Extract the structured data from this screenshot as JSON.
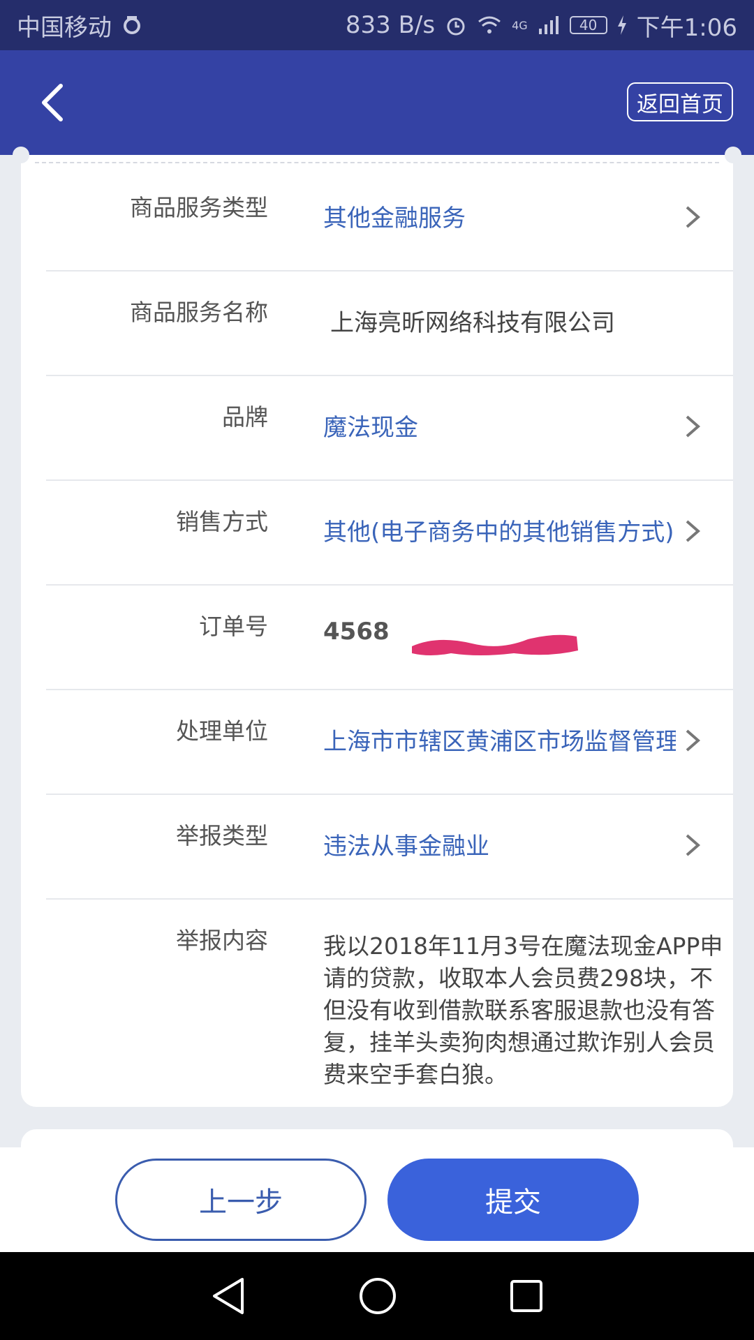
{
  "status_bar": {
    "carrier": "中国移动",
    "net_speed": "833 B/s",
    "network": "4G",
    "battery": "40",
    "time": "下午1:06"
  },
  "header": {
    "home_button": "返回首页"
  },
  "form": {
    "rows": [
      {
        "label": "商品服务类型",
        "value": "其他金融服务",
        "style": "link",
        "has_chevron": true
      },
      {
        "label": "商品服务名称",
        "value": "上海亮昕网络科技有限公司",
        "style": "plain",
        "has_chevron": false
      },
      {
        "label": "品牌",
        "value": "魔法现金",
        "style": "link",
        "has_chevron": true
      },
      {
        "label": "销售方式",
        "value": "其他(电子商务中的其他销售方式)",
        "style": "link",
        "has_chevron": true
      },
      {
        "label": "订单号",
        "value": "4568",
        "style": "bold",
        "has_chevron": false,
        "redacted": true
      },
      {
        "label": "处理单位",
        "value": "上海市市辖区黄浦区市场监督管理",
        "style": "link",
        "has_chevron": true
      },
      {
        "label": "举报类型",
        "value": "违法从事金融业",
        "style": "link",
        "has_chevron": true
      },
      {
        "label": "举报内容",
        "value": "我以2018年11月3号在魔法现金APP申请的贷款，收取本人会员费298块，不但没有收到借款联系客服退款也没有答复，挂羊头卖狗肉想通过欺诈别人会员费来空手套白狼。",
        "style": "plain",
        "has_chevron": false
      }
    ]
  },
  "actions": {
    "prev": "上一步",
    "submit": "提交"
  },
  "colors": {
    "status_bar": "#252d6b",
    "header": "#3442a4",
    "link": "#3a64b9",
    "primary_button": "#3a62db",
    "redaction": "#e0336f"
  },
  "icons": {
    "back": "chevron-left-icon",
    "row_arrow": "chevron-right-icon",
    "nav_back": "triangle-back-icon",
    "nav_home": "circle-home-icon",
    "nav_recent": "square-recent-icon"
  }
}
